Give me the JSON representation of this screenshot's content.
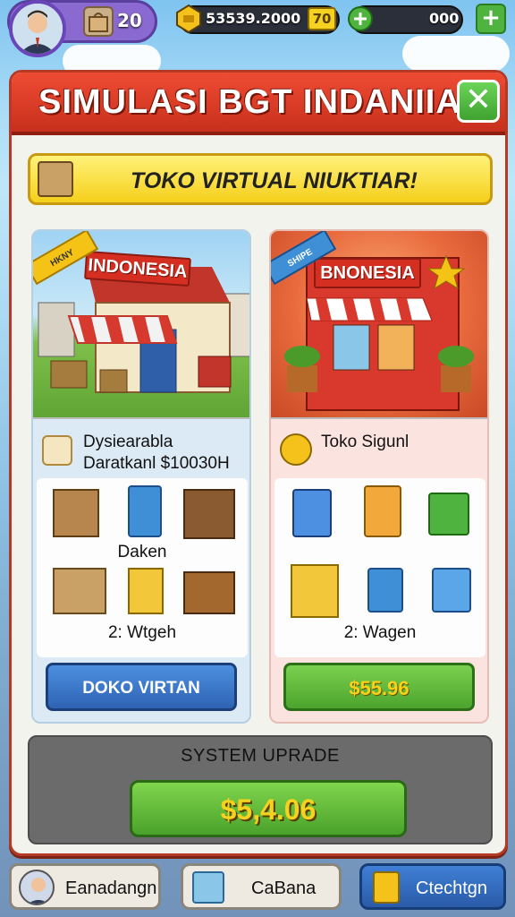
{
  "hud": {
    "bag_count": "20",
    "money": "53539.2000",
    "level_badge": "70",
    "gems": "000",
    "colors": {
      "profile": "#8a6ad1",
      "bar": "#2b2f3a",
      "gold": "#f4c21b",
      "green": "#4fb33f"
    },
    "icons": [
      "avatar",
      "shopping-bag-icon",
      "gold-bars-icon",
      "green-gem-icon",
      "plus-icon"
    ]
  },
  "panel": {
    "title": "SIMULASI BGT INDANIIA",
    "close_label": "✕",
    "banner_text": "TOKO VIRTUAL NIUKTIAR!"
  },
  "cards": [
    {
      "ribbon": "HKNY",
      "store_sign": "INDONESIA",
      "desc_line1": "Dysiearabla",
      "desc_line2": "Daratkanl $10030H",
      "item_label_mid": "Daken",
      "item_label_bottom": "2: Wtgeh",
      "button_label": "DOKO VIRTAN"
    },
    {
      "ribbon": "SHIPE",
      "store_sign": "BNONESIA",
      "desc_line1": "Toko Sigunl",
      "item_label_bottom": "2: Wagen",
      "button_label": "$55.96"
    }
  ],
  "upgrade": {
    "title": "SYSTEM UPRADE",
    "price": "$5,4.06"
  },
  "nav": [
    {
      "label": "Eanadangn",
      "icon": "person-icon"
    },
    {
      "label": "CaBana",
      "icon": "box-icon"
    },
    {
      "label": "Ctechtgn",
      "icon": "bag-icon"
    }
  ]
}
